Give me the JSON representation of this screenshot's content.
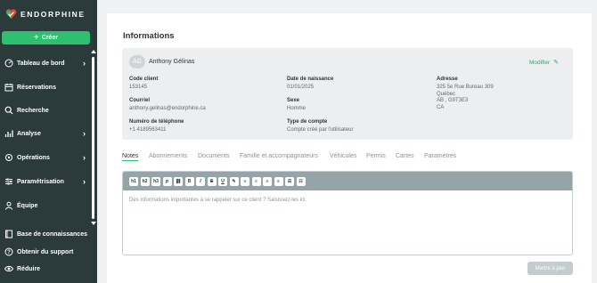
{
  "brand": {
    "name": "ENDORPHINE",
    "accent": "#2fbf71",
    "sidebar_bg": "#2b3a3b"
  },
  "sidebar": {
    "create_label": "Créer",
    "items": [
      {
        "label": "Tableau de bord",
        "icon": "dashboard-icon",
        "has_chevron": true
      },
      {
        "label": "Réservations",
        "icon": "calendar-icon",
        "has_chevron": false
      },
      {
        "label": "Recherche",
        "icon": "search-icon",
        "has_chevron": false
      },
      {
        "label": "Analyse",
        "icon": "chart-icon",
        "has_chevron": true
      },
      {
        "label": "Opérations",
        "icon": "operations-icon",
        "has_chevron": true
      },
      {
        "label": "Paramétrisation",
        "icon": "sliders-icon",
        "has_chevron": true
      },
      {
        "label": "Équipe",
        "icon": "team-icon",
        "has_chevron": false
      }
    ],
    "bottom_items": [
      {
        "label": "Base de connaissances",
        "icon": "book-icon"
      },
      {
        "label": "Obtenir du support",
        "icon": "help-icon"
      },
      {
        "label": "Réduire",
        "icon": "eye-icon"
      }
    ]
  },
  "page": {
    "title": "Informations"
  },
  "client": {
    "initials": "AG",
    "name": "Anthony Gélinas",
    "modify_label": "Modifier",
    "fields": {
      "code_label": "Code client",
      "code_value": "153145",
      "email_label": "Courriel",
      "email_value": "anthony.gelinas@endorphine.ca",
      "phone_label": "Numéro de téléphone",
      "phone_value": "+1 4189563411",
      "dob_label": "Date de naissance",
      "dob_value": "01/01/2025",
      "sex_label": "Sexe",
      "sex_value": "Homme",
      "account_label": "Type de compte",
      "account_value": "Compte créé par l'utilisateur",
      "address_label": "Adresse",
      "address_line1": "325 5e Rue Bureau 309",
      "address_line2": "Québec",
      "address_line3": "AB , G9T3E3",
      "address_line4": "CA"
    }
  },
  "tabs": {
    "items": [
      "Notes",
      "Abonnements",
      "Documents",
      "Famille et accompagnateurs",
      "Véhicules",
      "Permis",
      "Cartes",
      "Paramètres"
    ],
    "active": "Notes"
  },
  "editor": {
    "toolbar": [
      "h1",
      "h2",
      "h3",
      "p",
      "link",
      "B",
      "I",
      "S",
      "U",
      "highlight",
      "align-left",
      "align-center",
      "align-right",
      "align-justify",
      "bullet-list",
      "ordered-list"
    ],
    "placeholder": "Des informations importantes à se rappeler sur ce client ? Saisissez-les ici."
  },
  "update_label": "Mettre à jour"
}
